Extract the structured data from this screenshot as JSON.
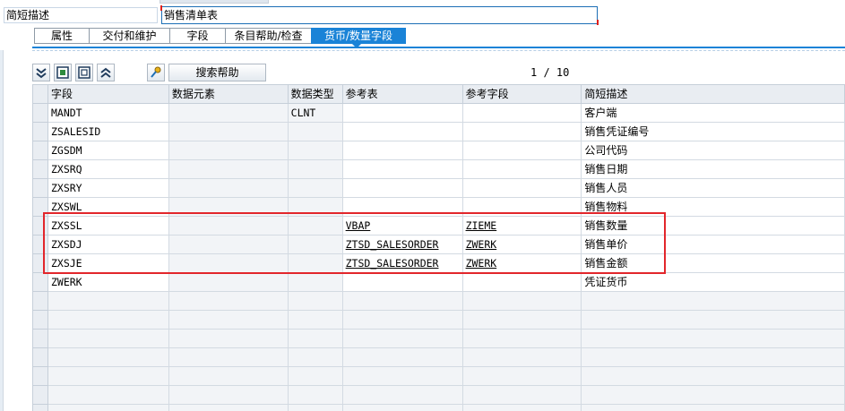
{
  "header": {
    "desc_label": "简短描述",
    "desc_value": "销售清单表"
  },
  "tabs": [
    {
      "label": "属性",
      "active": false
    },
    {
      "label": "交付和维护",
      "active": false
    },
    {
      "label": "字段",
      "active": false
    },
    {
      "label": "条目帮助/检查",
      "active": false
    },
    {
      "label": "货币/数量字段",
      "active": true
    }
  ],
  "toolbar": {
    "buttons": [
      "expand-all-icon",
      "select-block-icon",
      "deselect-block-icon",
      "collapse-all-icon",
      "search-help-key-icon"
    ],
    "search_help_label": "搜索帮助",
    "pager": "1 / 10"
  },
  "table": {
    "columns": [
      "字段",
      "数据元素",
      "数据类型",
      "参考表",
      "参考字段",
      "简短描述"
    ],
    "rows": [
      {
        "field": "MANDT",
        "data_element": "",
        "data_type": "CLNT",
        "ref_table": "",
        "ref_field": "",
        "desc": "客户端"
      },
      {
        "field": "ZSALESID",
        "data_element": "",
        "data_type": "",
        "ref_table": "",
        "ref_field": "",
        "desc": "销售凭证编号"
      },
      {
        "field": "ZGSDM",
        "data_element": "",
        "data_type": "",
        "ref_table": "",
        "ref_field": "",
        "desc": "公司代码"
      },
      {
        "field": "ZXSRQ",
        "data_element": "",
        "data_type": "",
        "ref_table": "",
        "ref_field": "",
        "desc": "销售日期"
      },
      {
        "field": "ZXSRY",
        "data_element": "",
        "data_type": "",
        "ref_table": "",
        "ref_field": "",
        "desc": "销售人员"
      },
      {
        "field": "ZXSWL",
        "data_element": "",
        "data_type": "",
        "ref_table": "",
        "ref_field": "",
        "desc": "销售物料"
      },
      {
        "field": "ZXSSL",
        "data_element": "",
        "data_type": "",
        "ref_table": "VBAP",
        "ref_field": "ZIEME",
        "desc": "销售数量"
      },
      {
        "field": "ZXSDJ",
        "data_element": "",
        "data_type": "",
        "ref_table": "ZTSD_SALESORDER",
        "ref_field": "ZWERK",
        "desc": "销售单价"
      },
      {
        "field": "ZXSJE",
        "data_element": "",
        "data_type": "",
        "ref_table": "ZTSD_SALESORDER",
        "ref_field": "ZWERK",
        "desc": "销售金额"
      },
      {
        "field": "ZWERK",
        "data_element": "",
        "data_type": "",
        "ref_table": "",
        "ref_field": "",
        "desc": "凭证货币"
      }
    ]
  },
  "colors": {
    "active_tab": "#1a83d7",
    "highlight_box": "#e2262b"
  }
}
